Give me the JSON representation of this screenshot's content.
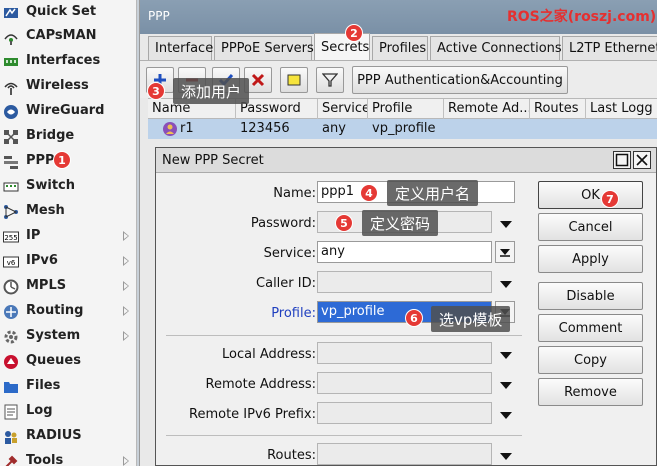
{
  "sidebar": {
    "items": [
      {
        "label": "Quick Set",
        "icon": "quick-set-icon",
        "has_submenu": false
      },
      {
        "label": "CAPsMAN",
        "icon": "capsman-icon",
        "has_submenu": false
      },
      {
        "label": "Interfaces",
        "icon": "interfaces-icon",
        "has_submenu": false
      },
      {
        "label": "Wireless",
        "icon": "wireless-icon",
        "has_submenu": false
      },
      {
        "label": "WireGuard",
        "icon": "wireguard-icon",
        "has_submenu": false
      },
      {
        "label": "Bridge",
        "icon": "bridge-icon",
        "has_submenu": false
      },
      {
        "label": "PPP",
        "icon": "ppp-icon",
        "has_submenu": false
      },
      {
        "label": "Switch",
        "icon": "switch-icon",
        "has_submenu": false
      },
      {
        "label": "Mesh",
        "icon": "mesh-icon",
        "has_submenu": false
      },
      {
        "label": "IP",
        "icon": "ip-icon",
        "icon_text": "255",
        "has_submenu": true
      },
      {
        "label": "IPv6",
        "icon": "ipv6-icon",
        "icon_text": "v6",
        "has_submenu": true
      },
      {
        "label": "MPLS",
        "icon": "mpls-icon",
        "has_submenu": true
      },
      {
        "label": "Routing",
        "icon": "routing-icon",
        "has_submenu": true
      },
      {
        "label": "System",
        "icon": "system-icon",
        "has_submenu": true
      },
      {
        "label": "Queues",
        "icon": "queues-icon",
        "has_submenu": false
      },
      {
        "label": "Files",
        "icon": "files-icon",
        "has_submenu": false
      },
      {
        "label": "Log",
        "icon": "log-icon",
        "has_submenu": false
      },
      {
        "label": "RADIUS",
        "icon": "radius-icon",
        "has_submenu": false
      },
      {
        "label": "Tools",
        "icon": "tools-icon",
        "has_submenu": true
      }
    ]
  },
  "ppp_window": {
    "title": "PPP",
    "watermark": "ROS之家(roszj.com)",
    "tabs": [
      "Interface",
      "PPPoE Servers",
      "Secrets",
      "Profiles",
      "Active Connections",
      "L2TP Ethernet"
    ],
    "active_tab": "Secrets",
    "toolbar": {
      "auth_button": "PPP Authentication&Accounting",
      "icons": [
        "add-icon",
        "remove-icon",
        "enable-icon",
        "disable-icon",
        "comment-icon",
        "filter-icon"
      ]
    },
    "table": {
      "columns": [
        "Name",
        "Password",
        "Service",
        "Profile",
        "Remote Ad...",
        "Routes",
        "Last Logg"
      ],
      "rows": [
        {
          "name": "r1",
          "password": "123456",
          "service": "any",
          "profile": "vp_profile",
          "remote_address": "",
          "routes": "",
          "last_logged_out": ""
        }
      ]
    }
  },
  "dialog": {
    "title": "New PPP Secret",
    "fields": {
      "name": {
        "label": "Name:",
        "value": "ppp1"
      },
      "password": {
        "label": "Password:",
        "value": ""
      },
      "service": {
        "label": "Service:",
        "value": "any"
      },
      "caller_id": {
        "label": "Caller ID:",
        "value": ""
      },
      "profile": {
        "label": "Profile:",
        "value": "vp_profile"
      },
      "local_address": {
        "label": "Local Address:",
        "value": ""
      },
      "remote_address": {
        "label": "Remote Address:",
        "value": ""
      },
      "remote_ipv6_prefix": {
        "label": "Remote IPv6 Prefix:",
        "value": ""
      },
      "routes": {
        "label": "Routes:",
        "value": ""
      }
    },
    "buttons": [
      "OK",
      "Cancel",
      "Apply",
      "Disable",
      "Comment",
      "Copy",
      "Remove"
    ]
  },
  "annotations": {
    "badges": [
      "1",
      "2",
      "3",
      "4",
      "5",
      "6",
      "7"
    ],
    "tags": {
      "add_user": "添加用户",
      "define_username": "定义用户名",
      "define_password": "定义密码",
      "select_template": "选vp模板"
    }
  },
  "colors": {
    "accent_red": "#e53935",
    "selection_blue": "#2d6ad6",
    "titlebar": "#7a90a6",
    "profile_label_blue": "#1f3fbf"
  }
}
